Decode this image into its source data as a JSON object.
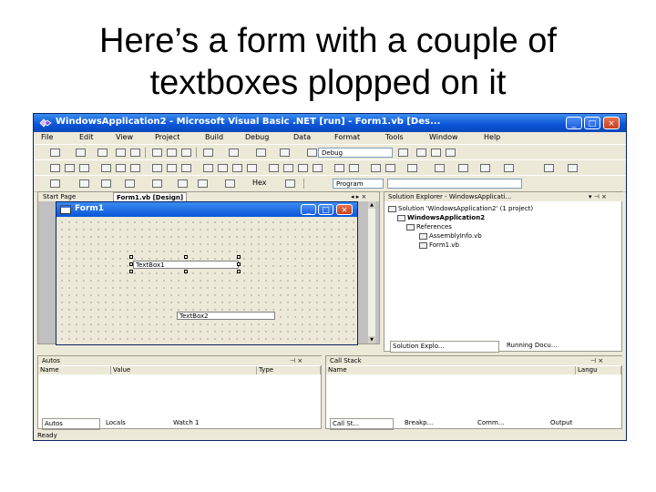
{
  "slide": {
    "title_line1": "Here’s a form with a couple of",
    "title_line2": "textboxes plopped on it"
  },
  "window": {
    "title": "WindowsApplication2 - Microsoft Visual Basic .NET [run] - Form1.vb [Des...",
    "minimize": "_",
    "maximize": "□",
    "close": "×"
  },
  "menu": [
    "File",
    "Edit",
    "View",
    "Project",
    "Build",
    "Debug",
    "Data",
    "Format",
    "Tools",
    "Window",
    "Help"
  ],
  "toolbar": {
    "config_value": "Debug",
    "hex_label": "Hex",
    "program_label": "Program"
  },
  "designer": {
    "tabs": [
      "Start Page",
      "Form1.vb [Design]"
    ],
    "form_title": "Form1",
    "textbox1": "TextBox1",
    "textbox2": "TextBox2"
  },
  "solution_explorer": {
    "header": "Solution Explorer - WindowsApplicati...",
    "items": [
      "Solution 'WindowsApplication2' (1 project)",
      "WindowsApplication2",
      "References",
      "AssemblyInfo.vb",
      "Form1.vb"
    ],
    "tabs": [
      "Solution Explo...",
      "Running Docu..."
    ]
  },
  "autos": {
    "header": "Autos",
    "columns": [
      "Name",
      "Value",
      "Type"
    ],
    "tabs": [
      "Autos",
      "Locals",
      "Watch 1"
    ]
  },
  "callstack": {
    "header": "Call Stack",
    "columns": [
      "Name",
      "Langu"
    ],
    "tabs": [
      "Call St...",
      "Breakp...",
      "Comm...",
      "Output"
    ]
  },
  "status": "Ready"
}
